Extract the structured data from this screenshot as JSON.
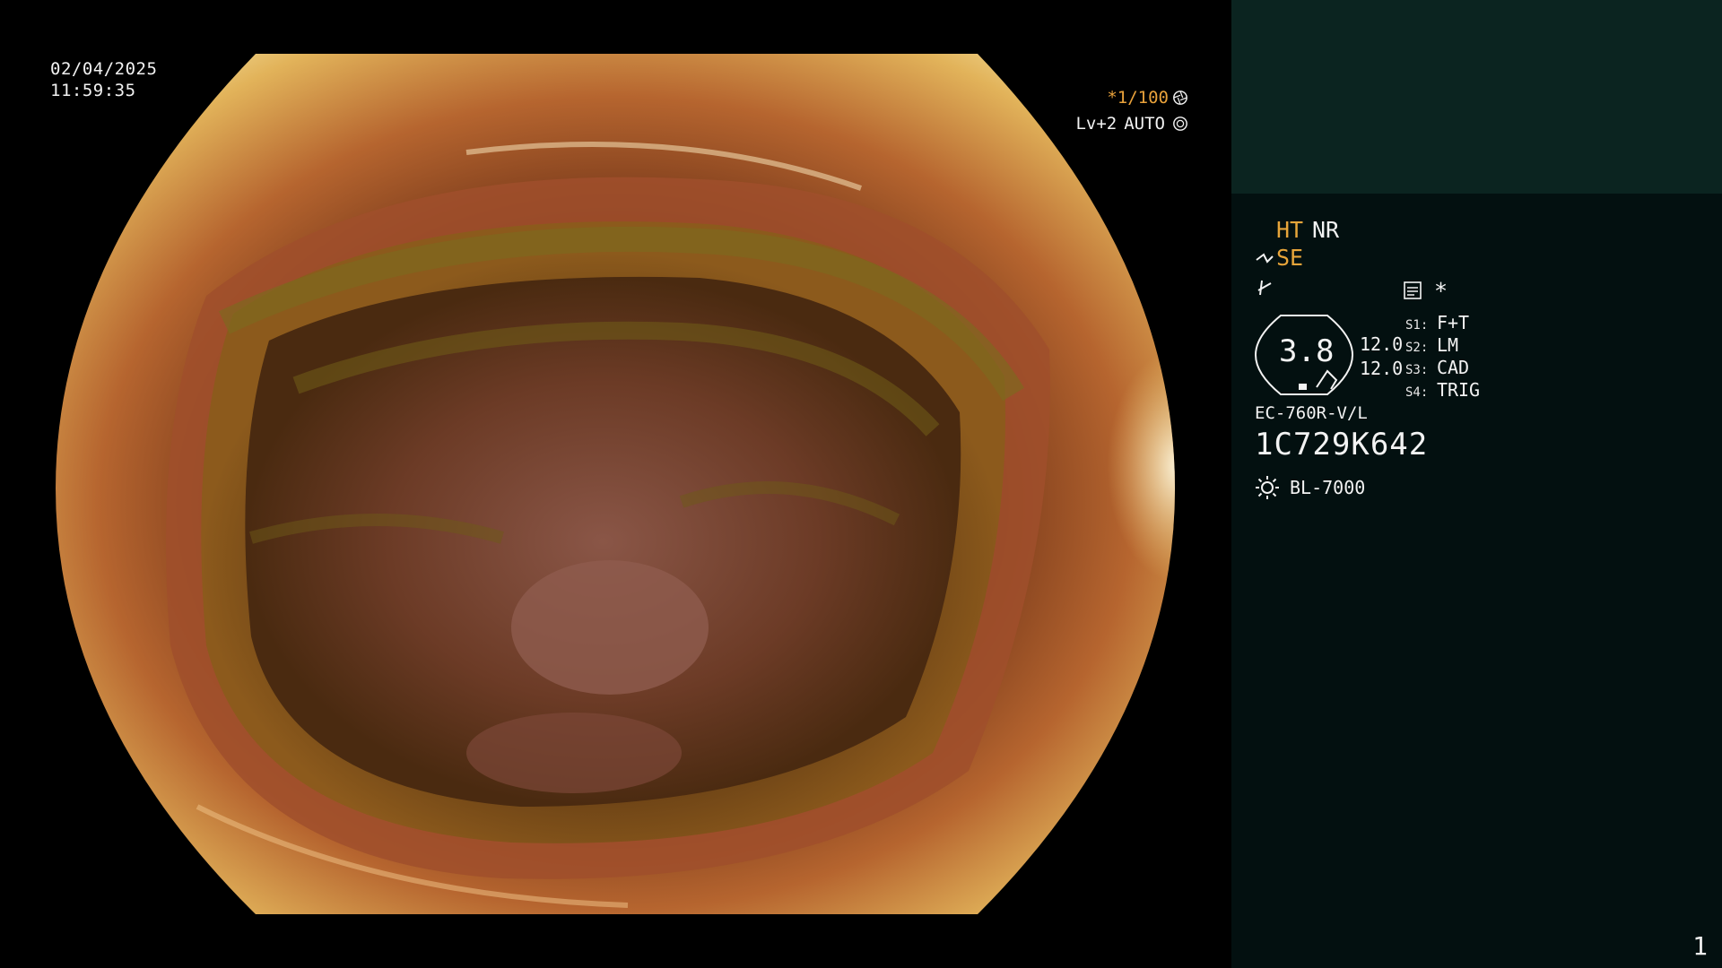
{
  "osd": {
    "date": "02/04/2025",
    "time": "11:59:35",
    "shutter": "*1/100",
    "shutter_icon": "aperture-icon",
    "iris_level": "Lv+2",
    "iris_mode": "AUTO",
    "iris_icon": "iris-icon"
  },
  "panel": {
    "ht_label": "HT",
    "nr_label": "NR",
    "se_label": "SE",
    "enhance_icon": "enhance-icon",
    "structure_icon": "structure-icon",
    "menu_icon": "menu-icon",
    "star_label": "*",
    "value_display": "3.8",
    "param_1": "12.0",
    "param_2": "12.0",
    "switches": [
      {
        "key": "S1",
        "value": "F+T"
      },
      {
        "key": "S2",
        "value": "LM"
      },
      {
        "key": "S3",
        "value": "CAD"
      },
      {
        "key": "S4",
        "value": "TRIG"
      }
    ],
    "scope_model": "EC-760R-V/L",
    "serial": "1C729K642",
    "light_icon": "sun-icon",
    "light_source": "BL-7000",
    "page_number": "1"
  },
  "colors": {
    "accent_orange": "#e7a53a",
    "panel_bg": "#031010",
    "panel_top_bg": "#0b2420"
  }
}
